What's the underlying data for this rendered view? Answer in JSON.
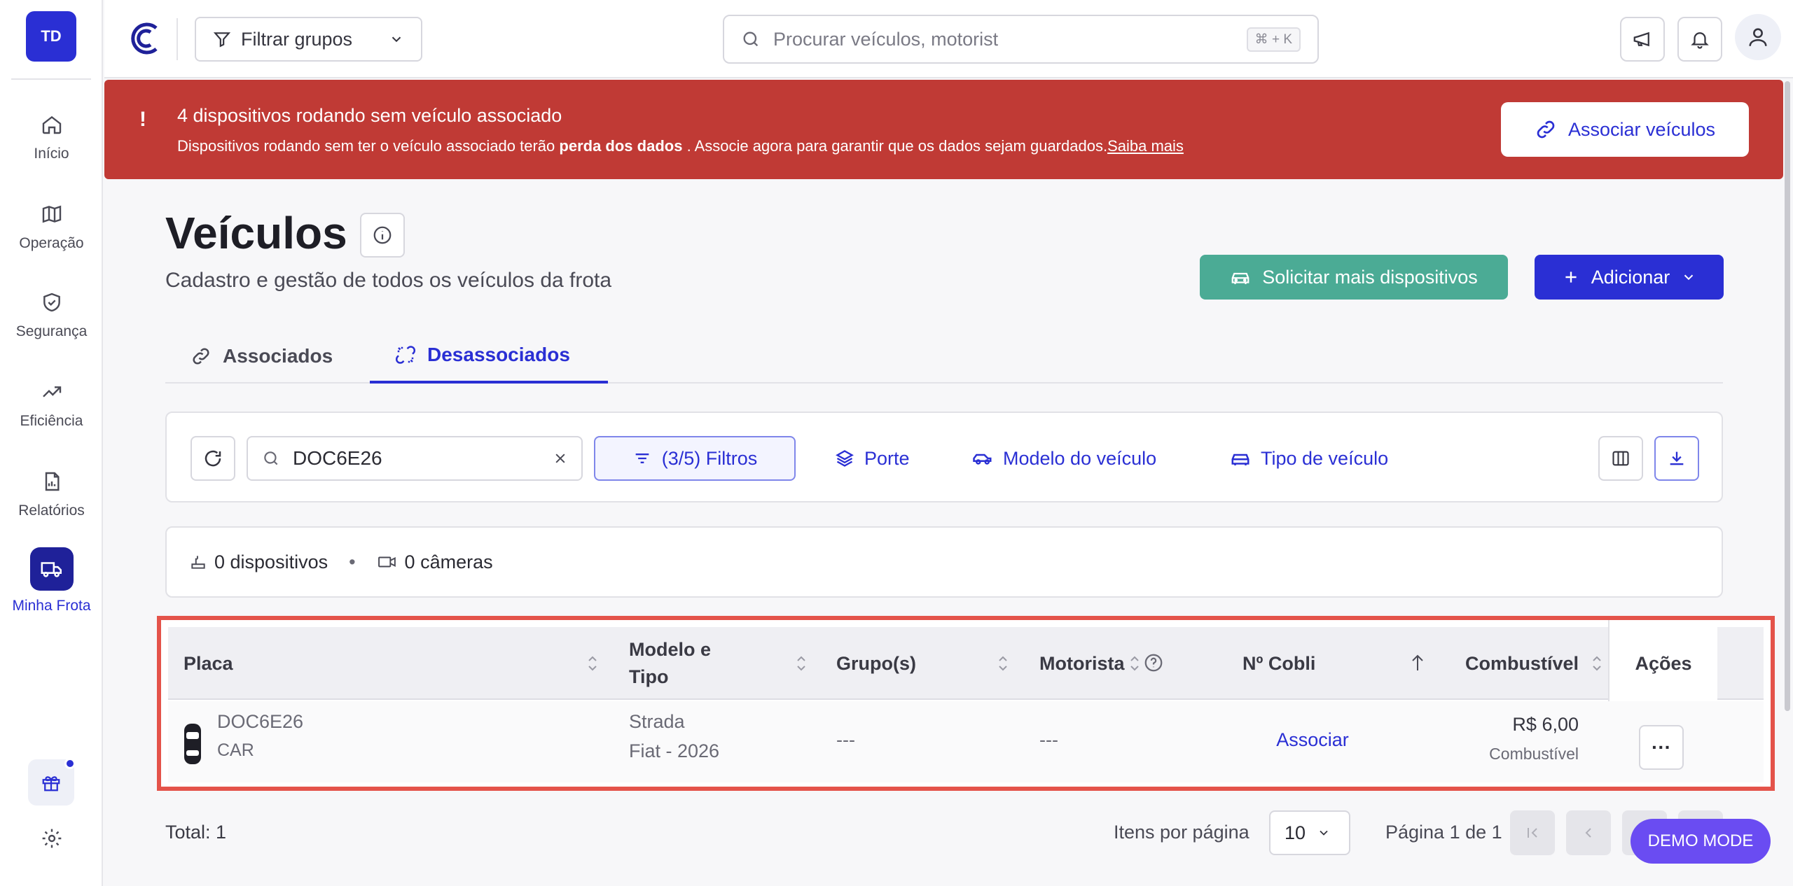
{
  "sidebar": {
    "avatar_initials": "TD",
    "items": [
      {
        "label": "Início",
        "icon": "home-icon"
      },
      {
        "label": "Operação",
        "icon": "map-icon"
      },
      {
        "label": "Segurança",
        "icon": "shield-icon"
      },
      {
        "label": "Eficiência",
        "icon": "trending-up-icon"
      },
      {
        "label": "Relatórios",
        "icon": "report-icon"
      },
      {
        "label": "Minha Frota",
        "icon": "truck-icon",
        "active": true
      }
    ]
  },
  "topbar": {
    "group_filter_label": "Filtrar grupos",
    "search_placeholder": "Procurar veículos, motorist",
    "search_shortcut": "⌘ + K"
  },
  "alert": {
    "title": "4 dispositivos rodando sem veículo associado",
    "message_pre": "Dispositivos rodando sem ter o veículo associado terão ",
    "message_bold": "perda dos dados",
    "message_post": " . Associe agora para garantir que os dados sejam guardados.",
    "learn_more": "Saiba mais",
    "button_label": "Associar veículos"
  },
  "page": {
    "title": "Veículos",
    "subtitle": "Cadastro e gestão de todos os veículos da frota",
    "request_button": "Solicitar mais dispositivos",
    "add_button": "Adicionar"
  },
  "tabs": [
    {
      "label": "Associados",
      "active": false
    },
    {
      "label": "Desassociados",
      "active": true
    }
  ],
  "filters": {
    "search_value": "DOC6E26",
    "filters_label": "(3/5) Filtros",
    "chips": [
      "Porte",
      "Modelo do veículo",
      "Tipo de veículo"
    ]
  },
  "summary": {
    "devices": "0 dispositivos",
    "separator": "•",
    "cameras": "0 câmeras"
  },
  "table": {
    "headers": {
      "placa": "Placa",
      "modelo_line1": "Modelo e",
      "modelo_line2": "Tipo",
      "grupos": "Grupo(s)",
      "motorista": "Motorista",
      "cobli": "Nº Cobli",
      "combustivel": "Combustível",
      "acoes": "Ações"
    },
    "rows": [
      {
        "plate": "DOC6E26",
        "type": "CAR",
        "model": "Strada",
        "brand_year": "Fiat - 2026",
        "groups": "---",
        "driver": "---",
        "cobli": "Associar",
        "fuel_price": "R$ 6,00",
        "fuel_label": "Combustível",
        "actions": "···"
      }
    ]
  },
  "footer": {
    "total": "Total: 1",
    "per_page_label": "Itens por página",
    "per_page_value": "10",
    "page_info": "Página 1 de 1"
  },
  "demo_mode": "DEMO MODE",
  "colors": {
    "primary": "#2a2fd4",
    "alert_red": "#c03a35",
    "green": "#4bab95",
    "highlight": "#e4534a",
    "demo": "#6a4cf2"
  }
}
